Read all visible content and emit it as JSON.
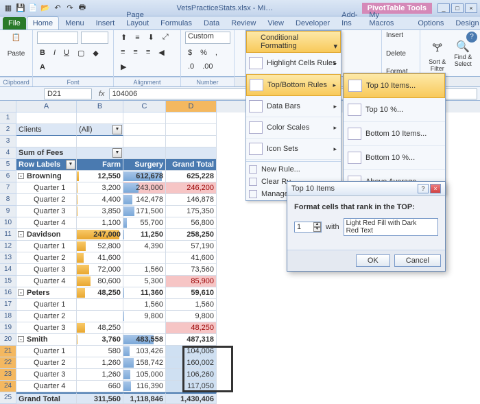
{
  "title": "VetsPracticeStats.xlsx - Mi…",
  "ptools": "PivotTable Tools",
  "tabs": [
    "File",
    "Home",
    "Menu",
    "Insert",
    "Page Layout",
    "Formulas",
    "Data",
    "Review",
    "View",
    "Developer",
    "Add-Ins",
    "My Macros",
    "Options",
    "Design"
  ],
  "ribbon": {
    "paste": "Paste",
    "clipboard": "Clipboard",
    "fontgrp": "Font",
    "aligngrp": "Alignment",
    "numgrp": "Number",
    "numfmt": "Custom",
    "insert": "Insert",
    "delete": "Delete",
    "format": "Format",
    "sortfilter": "Sort & Filter",
    "findselect": "Find & Select"
  },
  "cf": {
    "btn": "Conditional Formatting",
    "hlr": "Highlight Cells Rules",
    "tbr": "Top/Bottom Rules",
    "db": "Data Bars",
    "cs": "Color Scales",
    "is": "Icon Sets",
    "nr": "New Rule...",
    "cr": "Clear Ru",
    "mr": "Manage"
  },
  "sub": {
    "t10i": "Top 10 Items...",
    "t10p": "Top 10 %...",
    "b10i": "Bottom 10 Items...",
    "b10p": "Bottom 10 %...",
    "avg": "Above Average"
  },
  "namebox": "D21",
  "formula": "104006",
  "cols": [
    "A",
    "B",
    "C",
    "D"
  ],
  "pt": {
    "filterLabel": "Clients",
    "filterValue": "(All)",
    "sumof": "Sum of Fees",
    "rowlabels": "Row Labels",
    "farm": "Farm",
    "surgery": "Surgery",
    "gt": "Grand Total"
  },
  "rows": [
    {
      "r": 6,
      "label": "Browning",
      "exp": "-",
      "b": "12,550",
      "c": "612,678",
      "d": "625,228"
    },
    {
      "r": 7,
      "label": "Quarter 1",
      "b": "3,200",
      "c": "243,000",
      "d": "246,200",
      "cred": true,
      "dred": true
    },
    {
      "r": 8,
      "label": "Quarter 2",
      "b": "4,400",
      "c": "142,478",
      "d": "146,878"
    },
    {
      "r": 9,
      "label": "Quarter 3",
      "b": "3,850",
      "c": "171,500",
      "d": "175,350"
    },
    {
      "r": 10,
      "label": "Quarter 4",
      "b": "1,100",
      "c": "55,700",
      "d": "56,800"
    },
    {
      "r": 11,
      "label": "Davidson",
      "exp": "-",
      "b": "247,000",
      "c": "11,250",
      "d": "258,250"
    },
    {
      "r": 12,
      "label": "Quarter 1",
      "b": "52,800",
      "c": "4,390",
      "d": "57,190"
    },
    {
      "r": 13,
      "label": "Quarter 2",
      "b": "41,600",
      "c": "",
      "d": "41,600"
    },
    {
      "r": 14,
      "label": "Quarter 3",
      "b": "72,000",
      "c": "1,560",
      "d": "73,560"
    },
    {
      "r": 15,
      "label": "Quarter 4",
      "b": "80,600",
      "c": "5,300",
      "d": "85,900",
      "dred": true
    },
    {
      "r": 16,
      "label": "Peters",
      "exp": "-",
      "b": "48,250",
      "c": "11,360",
      "d": "59,610"
    },
    {
      "r": 17,
      "label": "Quarter 1",
      "b": "",
      "c": "1,560",
      "d": "1,560"
    },
    {
      "r": 18,
      "label": "Quarter 2",
      "b": "",
      "c": "9,800",
      "d": "9,800"
    },
    {
      "r": 19,
      "label": "Quarter 3",
      "b": "48,250",
      "c": "",
      "d": "48,250",
      "dred": true
    },
    {
      "r": 20,
      "label": "Smith",
      "exp": "-",
      "b": "3,760",
      "c": "483,558",
      "d": "487,318"
    },
    {
      "r": 21,
      "label": "Quarter 1",
      "b": "580",
      "c": "103,426",
      "d": "104,006"
    },
    {
      "r": 22,
      "label": "Quarter 2",
      "b": "1,260",
      "c": "158,742",
      "d": "160,002"
    },
    {
      "r": 23,
      "label": "Quarter 3",
      "b": "1,260",
      "c": "105,000",
      "d": "106,260"
    },
    {
      "r": 24,
      "label": "Quarter 4",
      "b": "660",
      "c": "116,390",
      "d": "117,050"
    }
  ],
  "grandtotal": {
    "label": "Grand Total",
    "b": "311,560",
    "c": "1,118,846",
    "d": "1,430,406"
  },
  "dialog": {
    "title": "Top 10 Items",
    "prompt": "Format cells that rank in the TOP:",
    "value": "1",
    "with": "with",
    "style": "Light Red Fill with Dark Red Text",
    "ok": "OK",
    "cancel": "Cancel"
  }
}
